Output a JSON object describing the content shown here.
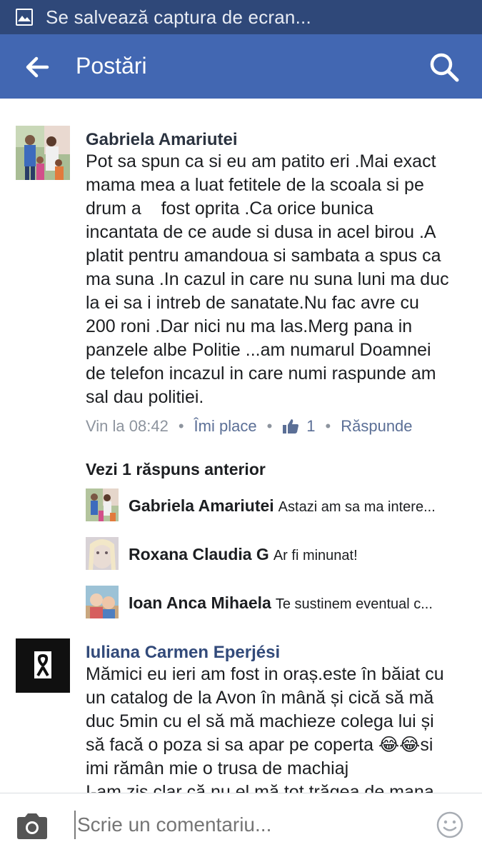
{
  "status_bar": {
    "text": "Se salvează captura de ecran..."
  },
  "app_bar": {
    "title": "Postări"
  },
  "comments": [
    {
      "author": "Gabriela Amariutei",
      "lines": [
        "Pot sa spun ca si eu am patito eri .Mai exact",
        "mama mea a luat fetitele de la scoala si pe",
        "drum a    fost oprita .Ca orice bunica",
        "incantata de ce aude si dusa in acel birou .A",
        "platit pentru amandoua si sambata a spus ca",
        "ma suna .In cazul in care nu suna luni ma duc",
        "la ei sa i intreb de sanatate.Nu fac avre cu",
        "200 roni .Dar nici nu ma las.Merg pana in",
        "panzele albe Politie ...am numarul Doamnei",
        "de telefon incazul in care numi raspunde am",
        "sal dau politiei."
      ],
      "time": "Vin la 08:42",
      "like_label": "Îmi place",
      "like_count": "1",
      "reply_label": "Răspunde"
    },
    {
      "author": "Iuliana Carmen Eperjési",
      "lines": [
        "Mămici eu ieri am fost in oraș.este în băiat cu",
        "un catalog de la Avon în mână și cică să mă",
        "duc 5min cu el să mă machieze colega lui și",
        "să facă o poza si sa apar pe coperta 😂😂si",
        "imi rămân mie o trusa de machiaj",
        "I-am zis clar că nu el mă tot trăgea de mana"
      ]
    }
  ],
  "replies": {
    "previous_label": "Vezi 1 răspuns anterior",
    "items": [
      {
        "name": "Gabriela Amariutei",
        "text": "Astazi am sa ma intere..."
      },
      {
        "name": "Roxana Claudia G",
        "text": "Ar fi minunat!"
      },
      {
        "name": "Ioan Anca Mihaela",
        "text": "Te sustinem eventual c..."
      }
    ]
  },
  "composer": {
    "placeholder": "Scrie un comentariu..."
  },
  "colors": {
    "status_bar": "#2f4879",
    "app_bar": "#4267b2",
    "link": "#5b6f96",
    "muted": "#8d949e"
  }
}
